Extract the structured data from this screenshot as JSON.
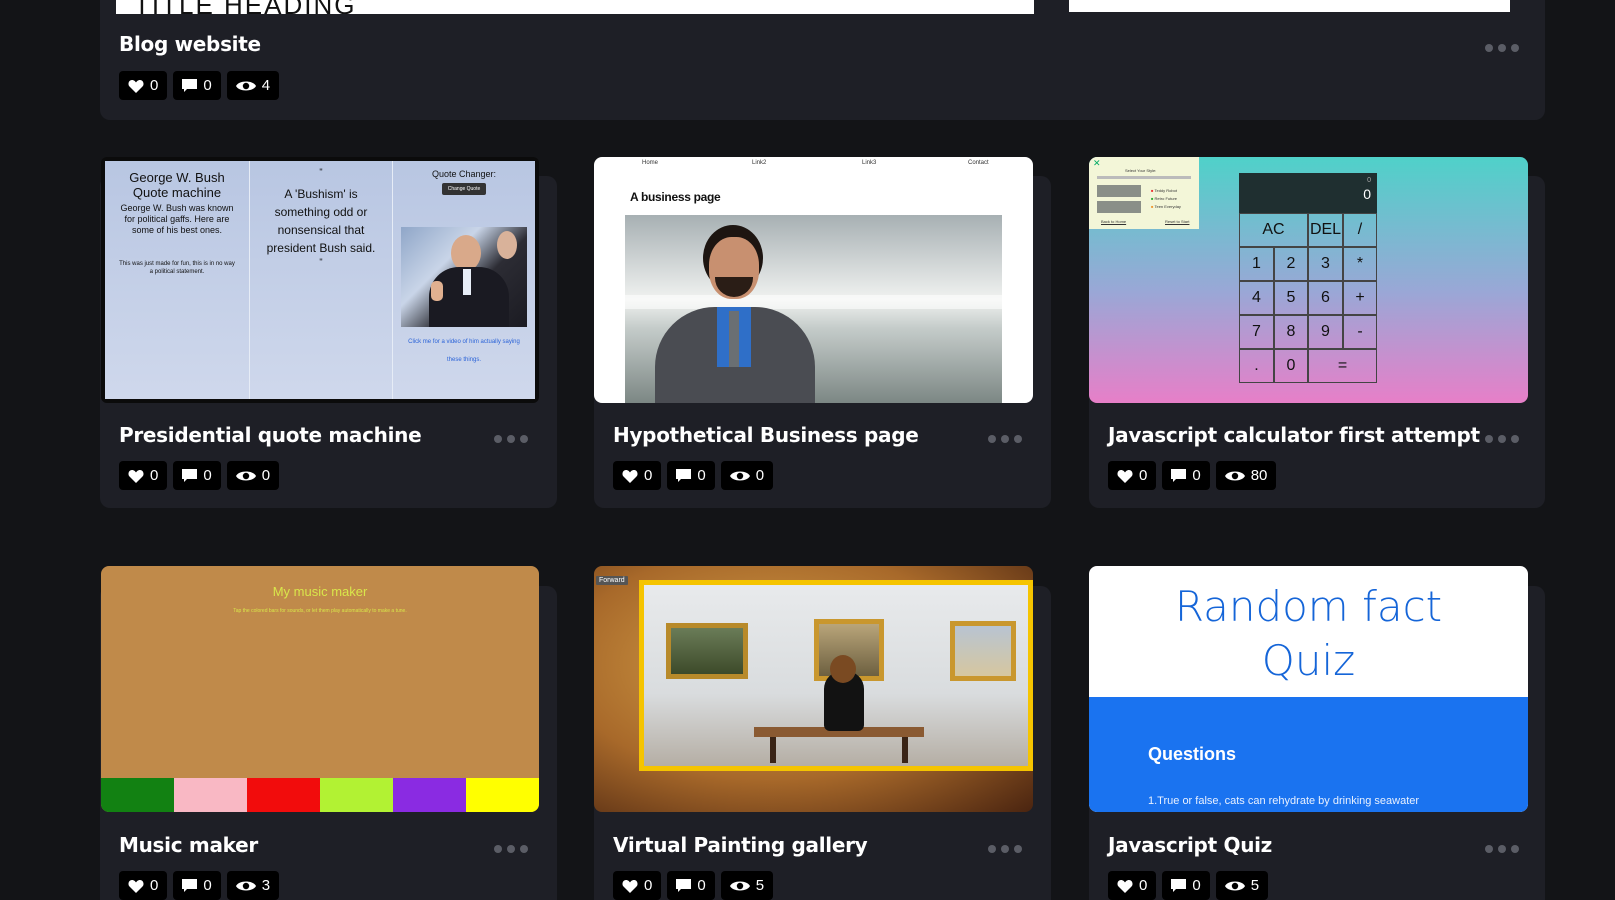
{
  "cards": [
    {
      "title": "Blog website",
      "likes": "0",
      "comments": "0",
      "views": "4",
      "thumb_heading": "TITLE HEADING"
    },
    {
      "title": "Presidential quote machine",
      "likes": "0",
      "comments": "0",
      "views": "0"
    },
    {
      "title": "Hypothetical Business page",
      "likes": "0",
      "comments": "0",
      "views": "0"
    },
    {
      "title": "Javascript calculator first attempt",
      "likes": "0",
      "comments": "0",
      "views": "80"
    },
    {
      "title": "Music maker",
      "likes": "0",
      "comments": "0",
      "views": "3"
    },
    {
      "title": "Virtual Painting gallery",
      "likes": "0",
      "comments": "0",
      "views": "5"
    },
    {
      "title": "Javascript Quiz",
      "likes": "0",
      "comments": "0",
      "views": "5"
    }
  ],
  "quote_thumb": {
    "col1_title": "George W. Bush Quote machine",
    "col1_text": "George W. Bush was known for political gaffs. Here are some of his best ones.",
    "col1_note": "This was just made for fun, this is in no way a political statement.",
    "col2_quote": "A 'Bushism' is something odd or nonsensical that president Bush said.",
    "col3_title": "Quote Changer:",
    "col3_button": "Change Quote",
    "col3_link": "Click me for a video of him actually saying these things."
  },
  "business_thumb": {
    "nav": [
      "Home",
      "Link2",
      "Link3",
      "Contact"
    ],
    "heading": "A business page"
  },
  "calc_thumb": {
    "display_small": "0",
    "display": "0",
    "keys": [
      "AC",
      "DEL",
      "/",
      "1",
      "2",
      "3",
      "*",
      "4",
      "5",
      "6",
      "+",
      "7",
      "8",
      "9",
      "-",
      ".",
      "0",
      "="
    ],
    "popup_title": "Select Your Style:",
    "popup_options": [
      "Teddy Robot",
      "Retro Future",
      "Teen Everyday"
    ],
    "popup_links": [
      "Back to Home",
      "Reset to Start"
    ]
  },
  "music_thumb": {
    "title": "My music maker",
    "subtitle": "Tap the colored bars for sounds, or let them play automatically to make a tune.",
    "bar_colors": [
      "#128112",
      "#f9b8c4",
      "#f20c0c",
      "#b2f233",
      "#8a2be2",
      "#ffff00"
    ]
  },
  "gallery_thumb": {
    "button": "Forward"
  },
  "quiz_thumb": {
    "title_line1": "Random fact",
    "title_line2": "Quiz",
    "section": "Questions",
    "question": "1.True or false, cats can rehydrate by drinking seawater"
  }
}
